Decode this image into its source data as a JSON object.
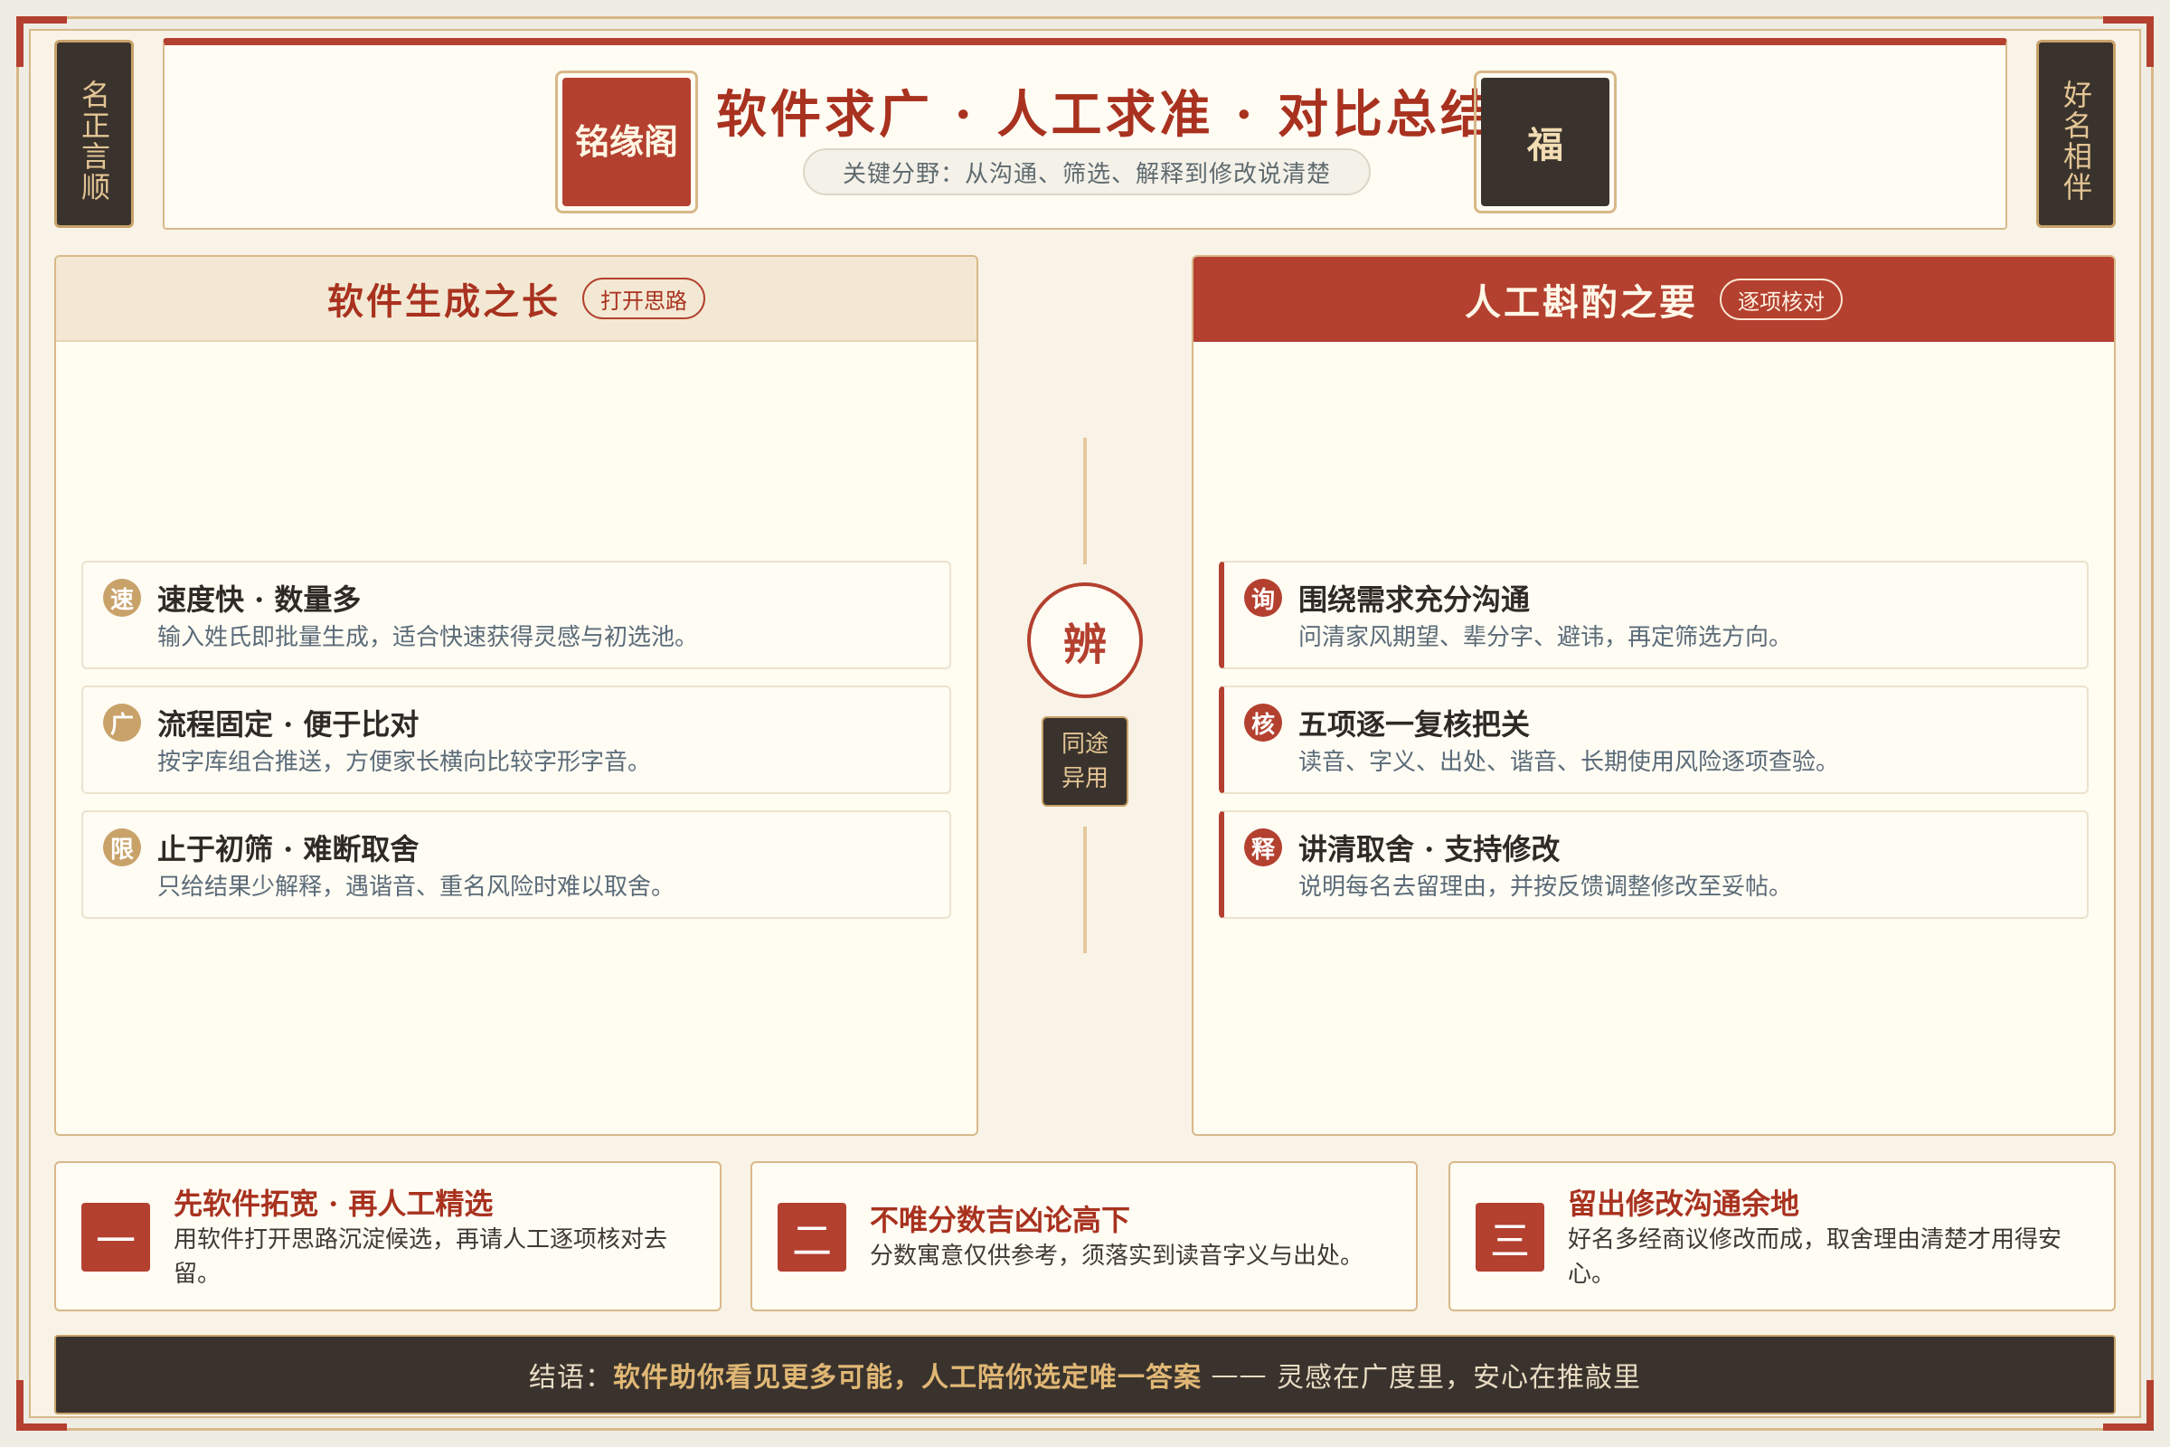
{
  "side": {
    "left": "名正言顺",
    "right": "好名相伴"
  },
  "header": {
    "logo": "铭缘阁",
    "title": "软件求广 · 人工求准 · 对比总结",
    "subtitle": "关键分野：从沟通、筛选、解释到修改说清楚",
    "seal": "福"
  },
  "left_panel": {
    "title": "软件生成之长",
    "tag": "打开思路",
    "items": [
      {
        "badge": "速",
        "title": "速度快 · 数量多",
        "desc": "输入姓氏即批量生成，适合快速获得灵感与初选池。"
      },
      {
        "badge": "广",
        "title": "流程固定 · 便于比对",
        "desc": "按字库组合推送，方便家长横向比较字形字音。"
      },
      {
        "badge": "限",
        "title": "止于初筛 · 难断取舍",
        "desc": "只给结果少解释，遇谐音、重名风险时难以取舍。"
      }
    ]
  },
  "right_panel": {
    "title": "人工斟酌之要",
    "tag": "逐项核对",
    "items": [
      {
        "badge": "询",
        "title": "围绕需求充分沟通",
        "desc": "问清家风期望、辈分字、避讳，再定筛选方向。"
      },
      {
        "badge": "核",
        "title": "五项逐一复核把关",
        "desc": "读音、字义、出处、谐音、长期使用风险逐项查验。"
      },
      {
        "badge": "释",
        "title": "讲清取舍 · 支持修改",
        "desc": "说明每名去留理由，并按反馈调整修改至妥帖。"
      }
    ]
  },
  "center": {
    "symbol": "辨",
    "label_1": "同途",
    "label_2": "异用"
  },
  "tips": [
    {
      "num": "一",
      "title": "先软件拓宽 · 再人工精选",
      "desc": "用软件打开思路沉淀候选，再请人工逐项核对去留。"
    },
    {
      "num": "二",
      "title": "不唯分数吉凶论高下",
      "desc": "分数寓意仅供参考，须落实到读音字义与出处。"
    },
    {
      "num": "三",
      "title": "留出修改沟通余地",
      "desc": "好名多经商议修改而成，取舍理由清楚才用得安心。"
    }
  ],
  "footer": {
    "prefix": "结语：",
    "emphasis": "软件助你看见更多可能，人工陪你选定唯一答案",
    "dash": " —— ",
    "suffix": "灵感在广度里，安心在推敲里"
  },
  "colors": {
    "accent": "#b4402f",
    "dark": "#3a332d",
    "gold": "#c9a26a",
    "paper": "#fffcf4"
  }
}
